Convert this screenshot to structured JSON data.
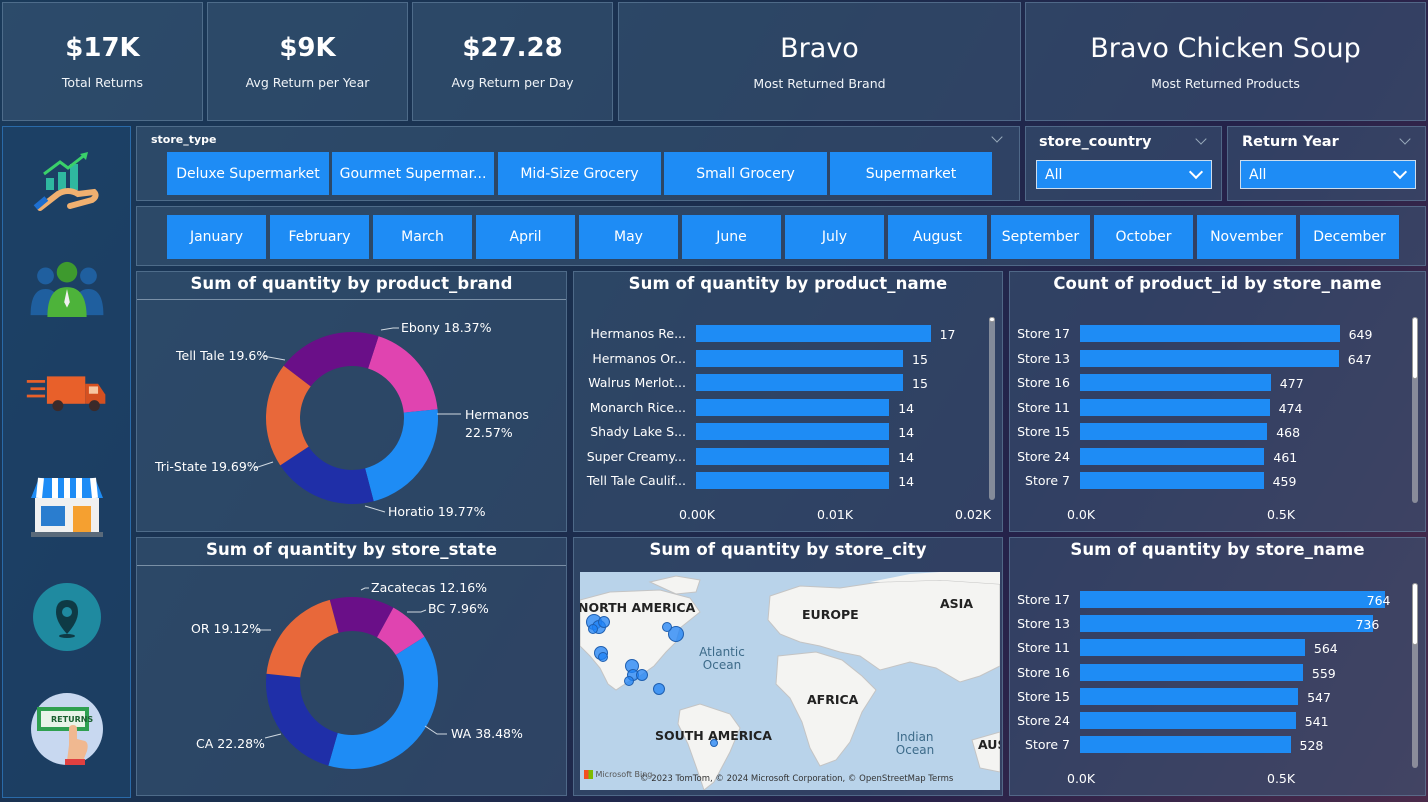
{
  "kpis": [
    {
      "value": "$17K",
      "label": "Total Returns"
    },
    {
      "value": "$9K",
      "label": "Avg Return per Year"
    },
    {
      "value": "$27.28",
      "label": "Avg Return per Day"
    },
    {
      "value": "Bravo",
      "label": "Most Returned Brand"
    },
    {
      "value": "Bravo Chicken Soup",
      "label": "Most Returned Products"
    }
  ],
  "sidebar": {
    "icons": [
      "sales-growth-icon",
      "customers-icon",
      "delivery-truck-icon",
      "store-icon",
      "location-pin-icon",
      "returns-icon"
    ],
    "returns_label": "RETURNS"
  },
  "store_type": {
    "title": "store_type",
    "options": [
      "Deluxe Supermarket",
      "Gourmet Supermar...",
      "Mid-Size Grocery",
      "Small Grocery",
      "Supermarket"
    ]
  },
  "store_country": {
    "title": "store_country",
    "value": "All"
  },
  "return_year": {
    "title": "Return Year",
    "value": "All"
  },
  "months": [
    "January",
    "February",
    "March",
    "April",
    "May",
    "June",
    "July",
    "August",
    "September",
    "October",
    "November",
    "December"
  ],
  "brand_donut": {
    "title": "Sum of quantity by product_brand",
    "chart_data": {
      "type": "pie",
      "slices": [
        {
          "label": "Ebony",
          "pct": "18.37%",
          "value": 18.37,
          "color": "#e044b0"
        },
        {
          "label": "Hermanos",
          "pct": "22.57%",
          "value": 22.57,
          "color": "#1e8cf5"
        },
        {
          "label": "Horatio",
          "pct": "19.77%",
          "value": 19.77,
          "color": "#1f2fa8"
        },
        {
          "label": "Tri-State",
          "pct": "19.69%",
          "value": 19.69,
          "color": "#e8683a"
        },
        {
          "label": "Tell Tale",
          "pct": "19.6%",
          "value": 19.6,
          "color": "#6a0f88"
        }
      ]
    }
  },
  "product_bars": {
    "title": "Sum of quantity by product_name",
    "chart_data": {
      "type": "bar",
      "categories": [
        "Hermanos Re...",
        "Hermanos Or...",
        "Walrus Merlot...",
        "Monarch Rice...",
        "Shady Lake S...",
        "Super Creamy...",
        "Tell Tale Caulif..."
      ],
      "values": [
        17,
        15,
        15,
        14,
        14,
        14,
        14
      ],
      "xlim": [
        0,
        20
      ],
      "ticks": [
        "0.00K",
        "0.01K",
        "0.02K"
      ]
    }
  },
  "store_count_bars": {
    "title": "Count of product_id by store_name",
    "chart_data": {
      "type": "bar",
      "categories": [
        "Store 17",
        "Store 13",
        "Store 16",
        "Store 11",
        "Store 15",
        "Store 24",
        "Store 7"
      ],
      "values": [
        649,
        647,
        477,
        474,
        468,
        461,
        459
      ],
      "xlim": [
        0,
        675
      ],
      "ticks": [
        "0.0K",
        "0.5K"
      ]
    }
  },
  "state_donut": {
    "title": "Sum of quantity by store_state",
    "chart_data": {
      "type": "pie",
      "slices": [
        {
          "label": "Zacatecas",
          "pct": "12.16%",
          "value": 12.16,
          "color": "#6a0f88"
        },
        {
          "label": "BC",
          "pct": "7.96%",
          "value": 7.96,
          "color": "#e044b0"
        },
        {
          "label": "WA",
          "pct": "38.48%",
          "value": 38.48,
          "color": "#1e8cf5"
        },
        {
          "label": "CA",
          "pct": "22.28%",
          "value": 22.28,
          "color": "#1f2fa8"
        },
        {
          "label": "OR",
          "pct": "19.12%",
          "value": 19.12,
          "color": "#e8683a"
        }
      ]
    }
  },
  "city_map": {
    "title": "Sum of quantity by store_city",
    "labels": {
      "na": "NORTH AMERICA",
      "eu": "EUROPE",
      "asia": "ASIA",
      "africa": "AFRICA",
      "sa": "SOUTH AMERICA",
      "aus": "AUS",
      "atlantic": "Atlantic Ocean",
      "indian": "Indian Ocean"
    },
    "attribution": "© 2023 TomTom, © 2024 Microsoft Corporation, © OpenStreetMap  Terms",
    "brand": "Microsoft Bing"
  },
  "store_qty_bars": {
    "title": "Sum of quantity by store_name",
    "chart_data": {
      "type": "bar",
      "categories": [
        "Store 17",
        "Store 13",
        "Store 11",
        "Store 16",
        "Store 15",
        "Store 24",
        "Store 7"
      ],
      "values": [
        764,
        736,
        564,
        559,
        547,
        541,
        528
      ],
      "xlim": [
        0,
        800
      ],
      "ticks": [
        "0.0K",
        "0.5K"
      ]
    }
  }
}
